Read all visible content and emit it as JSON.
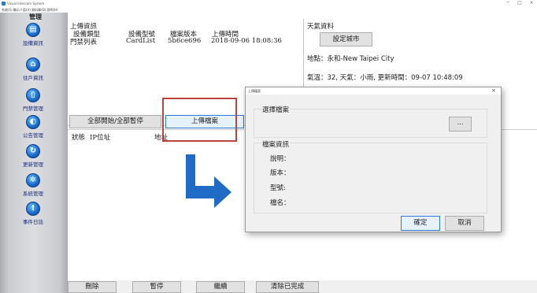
{
  "window": {
    "title": "Visual Intercom System",
    "menu": "系統(S)  顯示介面(V)  資料庫(D)  說明(H)",
    "controls": [
      "─",
      "□",
      "×"
    ]
  },
  "sidebar": {
    "header": "管理",
    "items": [
      {
        "label": "設備資訊",
        "icon": "monitor-icon",
        "glyph": "▤"
      },
      {
        "label": "住戶資訊",
        "icon": "house-icon",
        "glyph": "⌂"
      },
      {
        "label": "門禁管理",
        "icon": "door-icon",
        "glyph": "▯"
      },
      {
        "label": "公告管理",
        "icon": "compass-icon",
        "glyph": "◐"
      },
      {
        "label": "更新管理",
        "icon": "refresh-icon",
        "glyph": "↻"
      },
      {
        "label": "系統管理",
        "icon": "gear-icon",
        "glyph": "✲"
      },
      {
        "label": "事件日誌",
        "icon": "alert-icon",
        "glyph": "!"
      }
    ]
  },
  "upload_info": {
    "heading": "上傳資訊",
    "columns": [
      "設備類型",
      "設備型號",
      "檔案版本",
      "上傳時間"
    ],
    "row": [
      "門禁列表",
      "CardList",
      "5b6ce696",
      "2018-09-06 18:08:36"
    ]
  },
  "weather": {
    "heading": "天氣資料",
    "set_city_button": "設定城市",
    "location": "地點：永和-New Taipei City",
    "details": "氣溫：32, 天氣：小雨, 更新時間：09-07 10:48:09"
  },
  "toolbar": {
    "start_pause_all": "全部開始/全部暫停",
    "upload_file": "上傳檔案"
  },
  "table": {
    "columns": [
      "狀態",
      "IP位址",
      "地址"
    ]
  },
  "bottom": {
    "delete": "刪除",
    "pause": "暫停",
    "continue": "繼續",
    "clear_done": "清除已完成"
  },
  "dialog": {
    "title": "上傳檔案",
    "close": "×",
    "select_group": "選擇檔案",
    "browse_button": "...",
    "info_group": "檔案資訊",
    "fields": [
      "說明：",
      "版本：",
      "型號:",
      "檔名："
    ],
    "ok_button": "確定",
    "cancel_button": "取消"
  },
  "colors": {
    "arrow": "#1f6bc6",
    "highlight": "#b8453f",
    "primary_border": "#2c7ad6"
  }
}
